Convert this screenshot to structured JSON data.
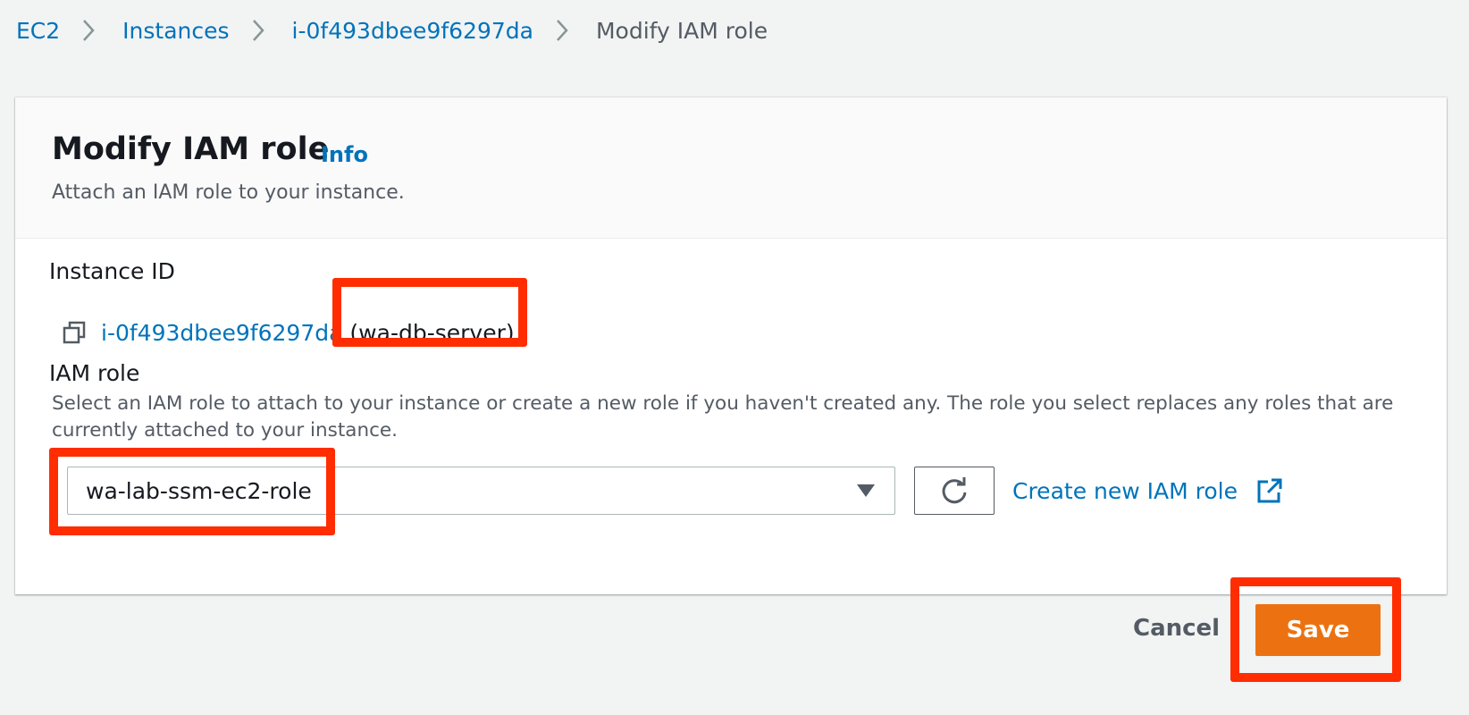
{
  "breadcrumb": {
    "items": [
      "EC2",
      "Instances",
      "i-0f493dbee9f6297da"
    ],
    "current": "Modify IAM role"
  },
  "panel": {
    "title": "Modify IAM role",
    "info": "Info",
    "description": "Attach an IAM role to your instance."
  },
  "instance": {
    "label": "Instance ID",
    "id": "i-0f493dbee9f6297da",
    "name": "(wa-db-server)"
  },
  "iam_role": {
    "label": "IAM role",
    "description": "Select an IAM role to attach to your instance or create a new role if you haven't created any. The role you select replaces any roles that are currently attached to your instance.",
    "selected": "wa-lab-ssm-ec2-role",
    "create_link": "Create new IAM role"
  },
  "actions": {
    "cancel": "Cancel",
    "save": "Save"
  },
  "colors": {
    "link": "#0073bb",
    "primary": "#ec7211",
    "highlight": "#ff2d00"
  },
  "icons": [
    "chevron-right-icon",
    "copy-icon",
    "caret-down-icon",
    "refresh-icon",
    "external-link-icon"
  ]
}
